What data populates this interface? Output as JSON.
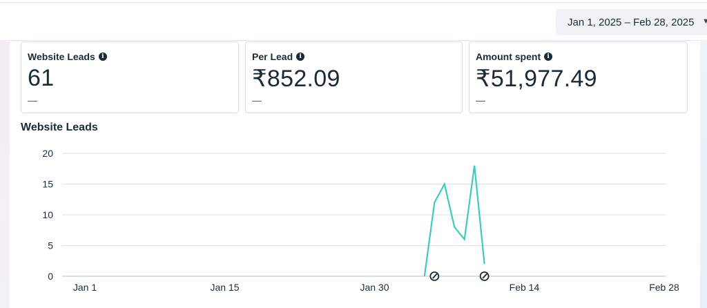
{
  "header": {
    "date_range": "Jan 1, 2025 – Feb 28, 2025"
  },
  "metrics": [
    {
      "label": "Website Leads",
      "value": "61",
      "change": "—"
    },
    {
      "label": "Per Lead",
      "value": "₹852.09",
      "change": "—"
    },
    {
      "label": "Amount spent",
      "value": "₹51,977.49",
      "change": "—"
    }
  ],
  "chart_section": {
    "title": "Website Leads"
  },
  "chart_data": {
    "type": "line",
    "title": "Website Leads",
    "xlabel": "",
    "ylabel": "",
    "x_tick_labels": [
      "Jan 1",
      "Jan 15",
      "Jan 30",
      "Feb 14",
      "Feb 28"
    ],
    "x_tick_days": [
      0,
      14,
      29,
      44,
      58
    ],
    "y_ticks": [
      0,
      5,
      10,
      15,
      20
    ],
    "ylim": [
      0,
      20
    ],
    "xlim_days": [
      0,
      58
    ],
    "grid": true,
    "line_color": "#3ec9c1",
    "series": [
      {
        "x_days": [
          34,
          35,
          36,
          37,
          38,
          39,
          40
        ],
        "values": [
          0,
          12,
          15,
          8,
          6,
          18,
          2
        ]
      }
    ],
    "marker_days": [
      35,
      40
    ]
  }
}
